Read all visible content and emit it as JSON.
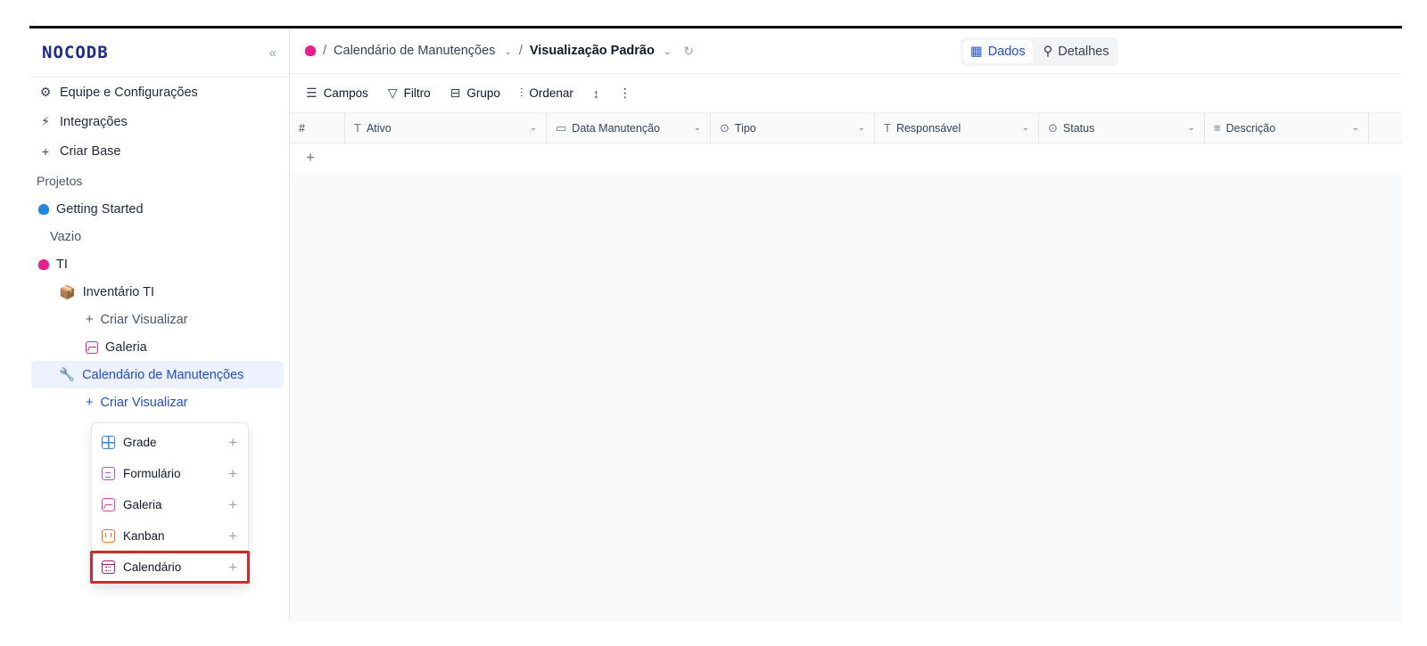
{
  "sidebar": {
    "logo": "NOCODB",
    "collapse_icon": "«",
    "nav": [
      {
        "label": "Equipe e Configurações",
        "icon": "gear-icon"
      },
      {
        "label": "Integrações",
        "icon": "plug-icon"
      },
      {
        "label": "Criar Base",
        "icon": "plus-icon"
      }
    ],
    "section_label": "Projetos",
    "projects": {
      "getting_started": "Getting Started",
      "empty": "Vazio",
      "ti": "TI",
      "inventario": "Inventário TI",
      "criar_visualizar_1": "Criar Visualizar",
      "galeria": "Galeria",
      "calendario_manutencoes": "Calendário de Manutenções",
      "criar_visualizar_2": "Criar Visualizar"
    },
    "view_menu": [
      {
        "label": "Grade",
        "icon": "grid-icon"
      },
      {
        "label": "Formulário",
        "icon": "form-icon"
      },
      {
        "label": "Galeria",
        "icon": "gallery-icon"
      },
      {
        "label": "Kanban",
        "icon": "kanban-icon"
      },
      {
        "label": "Calendário",
        "icon": "calendar-icon"
      }
    ]
  },
  "topbar": {
    "table_name": "Calendário de Manutenções",
    "view_name": "Visualização Padrão",
    "tab_data": "Dados",
    "tab_details": "Detalhes"
  },
  "toolbar": {
    "fields": "Campos",
    "filter": "Filtro",
    "group": "Grupo",
    "sort": "Ordenar"
  },
  "grid": {
    "row_number_header": "#",
    "columns": [
      {
        "label": "Ativo",
        "icon": "text-icon"
      },
      {
        "label": "Data Manutenção",
        "icon": "date-icon"
      },
      {
        "label": "Tipo",
        "icon": "select-icon"
      },
      {
        "label": "Responsável",
        "icon": "text-icon"
      },
      {
        "label": "Status",
        "icon": "select-icon"
      },
      {
        "label": "Descrição",
        "icon": "longtext-icon"
      }
    ],
    "add_row": "+"
  }
}
